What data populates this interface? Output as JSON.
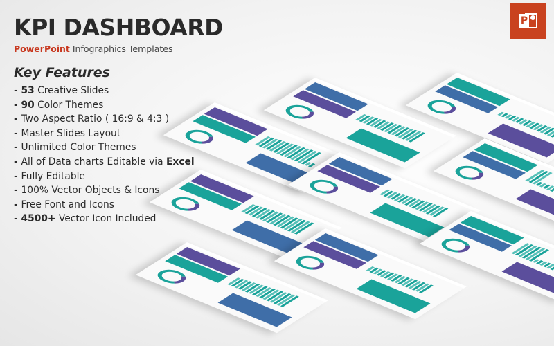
{
  "header": {
    "title": "KPI DASHBOARD",
    "subtitle_brand": "PowerPoint",
    "subtitle_rest": " Infographics Templates"
  },
  "features": {
    "heading": "Key Features",
    "items": [
      {
        "prefix": "- ",
        "bold": "53",
        "text": " Creative Slides"
      },
      {
        "prefix": "- ",
        "bold": "90",
        "text": " Color Themes"
      },
      {
        "prefix": "- ",
        "bold": "",
        "text": "Two Aspect Ratio ( 16:9 & 4:3 )"
      },
      {
        "prefix": "- ",
        "bold": "",
        "text": "Master Slides Layout"
      },
      {
        "prefix": "- ",
        "bold": "",
        "text": "Unlimited Color Themes"
      },
      {
        "prefix": "- ",
        "text": "All of Data charts Editable via ",
        "bold_end": "Excel"
      },
      {
        "prefix": "- ",
        "bold": "",
        "text": "Fully Editable"
      },
      {
        "prefix": "- ",
        "bold": "",
        "text": "100% Vector Objects & Icons"
      },
      {
        "prefix": "- ",
        "bold": "",
        "text": "Free Font and Icons"
      },
      {
        "prefix": "- ",
        "bold": "4500+",
        "text": " Vector Icon Included"
      }
    ]
  },
  "logo": {
    "icon": "powerpoint-icon",
    "letter": "P",
    "color": "#c9421f"
  },
  "colors": {
    "teal": "#1aa39a",
    "blue": "#3f6ea8",
    "purple": "#5b4e9c",
    "brand_red": "#c8381f"
  }
}
